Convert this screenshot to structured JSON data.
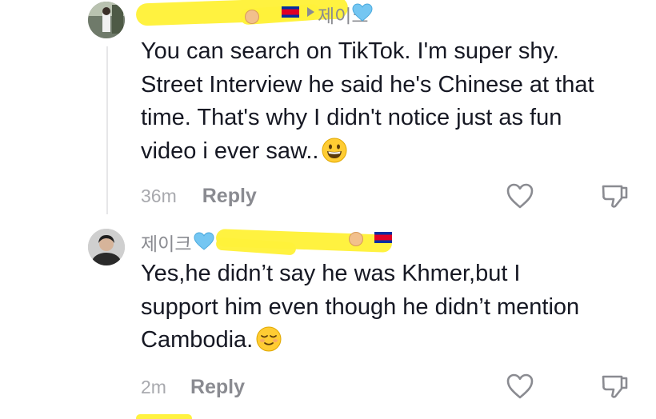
{
  "comments": [
    {
      "username": "제이크",
      "text_lines": [
        "You can search on TikTok. I'm super shy.",
        "Street Interview he said he's Chinese at that",
        "time. That's why I didn't notice just as fun",
        "video i ever saw.."
      ],
      "emoji": "grinning-face",
      "time": "36m",
      "reply_label": "Reply",
      "badge_emoji": "light-blue-heart"
    },
    {
      "username": "제이크",
      "text_lines": [
        "Yes,he didn’t say he was Khmer,but I",
        "support him even though he didn’t mention",
        "Cambodia."
      ],
      "emoji": "relieved-face",
      "time": "2m",
      "reply_label": "Reply",
      "badge_emoji": "light-blue-heart"
    }
  ],
  "icons": {
    "like": "heart-outline-icon",
    "dislike": "thumbs-down-outline-icon"
  },
  "colors": {
    "text": "#161823",
    "secondary": "#8a8b91",
    "highlight": "#fff23a",
    "heart_emoji": "#74c6f2"
  }
}
